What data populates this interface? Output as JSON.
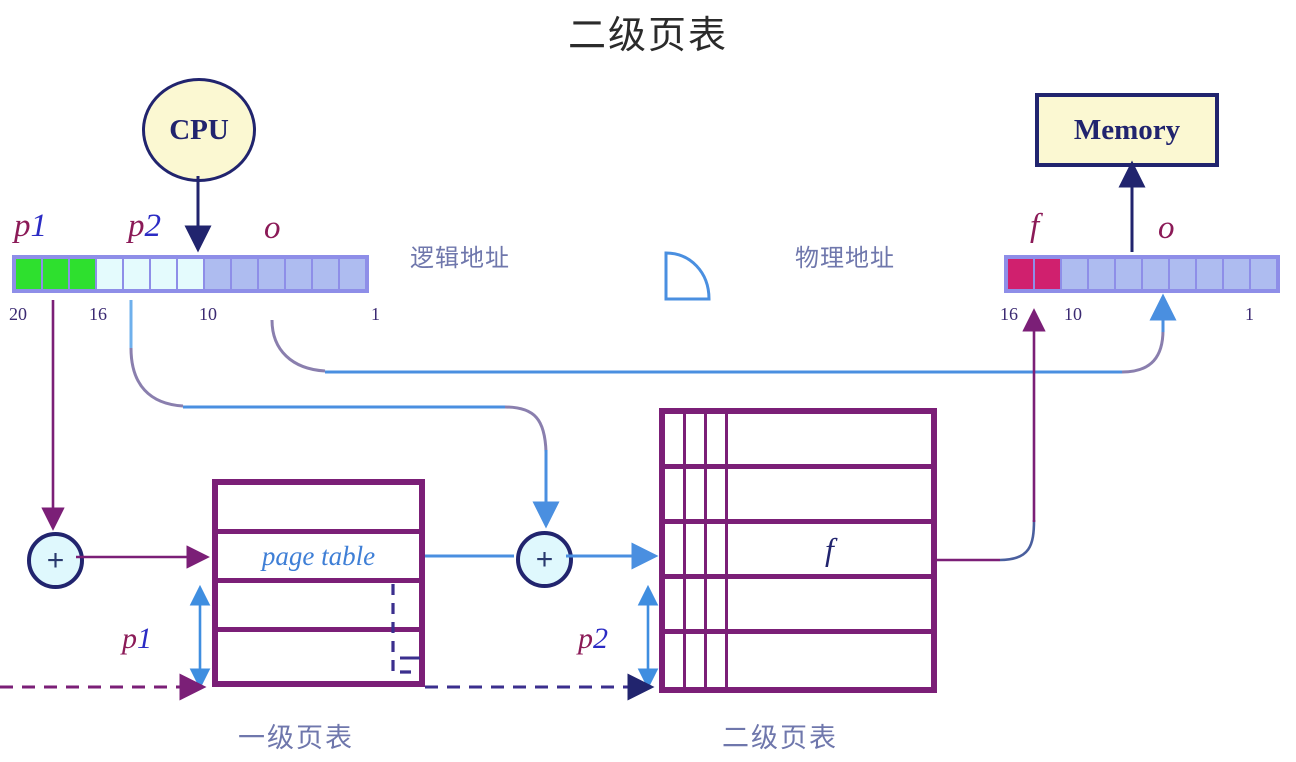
{
  "title": "二级页表",
  "cpu": {
    "label": "CPU"
  },
  "memory": {
    "label": "Memory"
  },
  "logical_address": {
    "caption": "逻辑地址",
    "fields": [
      {
        "name": "p1",
        "letter": "p",
        "num": "1",
        "cells": 3,
        "color": "#2ee02e"
      },
      {
        "name": "p2",
        "letter": "p",
        "num": "2",
        "cells": 4,
        "color": "#e4fbfd"
      },
      {
        "name": "o",
        "letter": "o",
        "num": "",
        "cells": 6,
        "color": "#aebcf0"
      }
    ],
    "bit_marks": [
      {
        "label": "20"
      },
      {
        "label": "16"
      },
      {
        "label": "10"
      },
      {
        "label": "1"
      }
    ]
  },
  "physical_address": {
    "caption": "物理地址",
    "fields": [
      {
        "name": "f",
        "letter": "f",
        "num": "",
        "cells": 2,
        "color": "#d0206e"
      },
      {
        "name": "o",
        "letter": "o",
        "num": "",
        "cells": 8,
        "color": "#aebcf0"
      }
    ],
    "bit_marks": [
      {
        "label": "16"
      },
      {
        "label": "10"
      },
      {
        "label": "1"
      }
    ]
  },
  "adders": [
    {
      "name": "adder-1",
      "symbol": "+"
    },
    {
      "name": "adder-2",
      "symbol": "+"
    }
  ],
  "page_table_1": {
    "caption": "一级页表",
    "entry_label": "page table",
    "entry_row_index": 1,
    "rows": 4,
    "measure_label": {
      "letter": "p",
      "num": "1"
    }
  },
  "page_table_2": {
    "caption": "二级页表",
    "entry_label": "f",
    "entry_row_index": 2,
    "rows": 5,
    "narrow_cols": 3,
    "measure_label": {
      "letter": "p",
      "num": "2"
    }
  },
  "colors": {
    "navy": "#21246e",
    "purple": "#7b1f77",
    "blue_link": "#4a8fe0",
    "magenta": "#d0206e",
    "green": "#2ee02e",
    "bar_border": "#8e8ee8",
    "cn_gray_blue": "#6f77ac"
  }
}
